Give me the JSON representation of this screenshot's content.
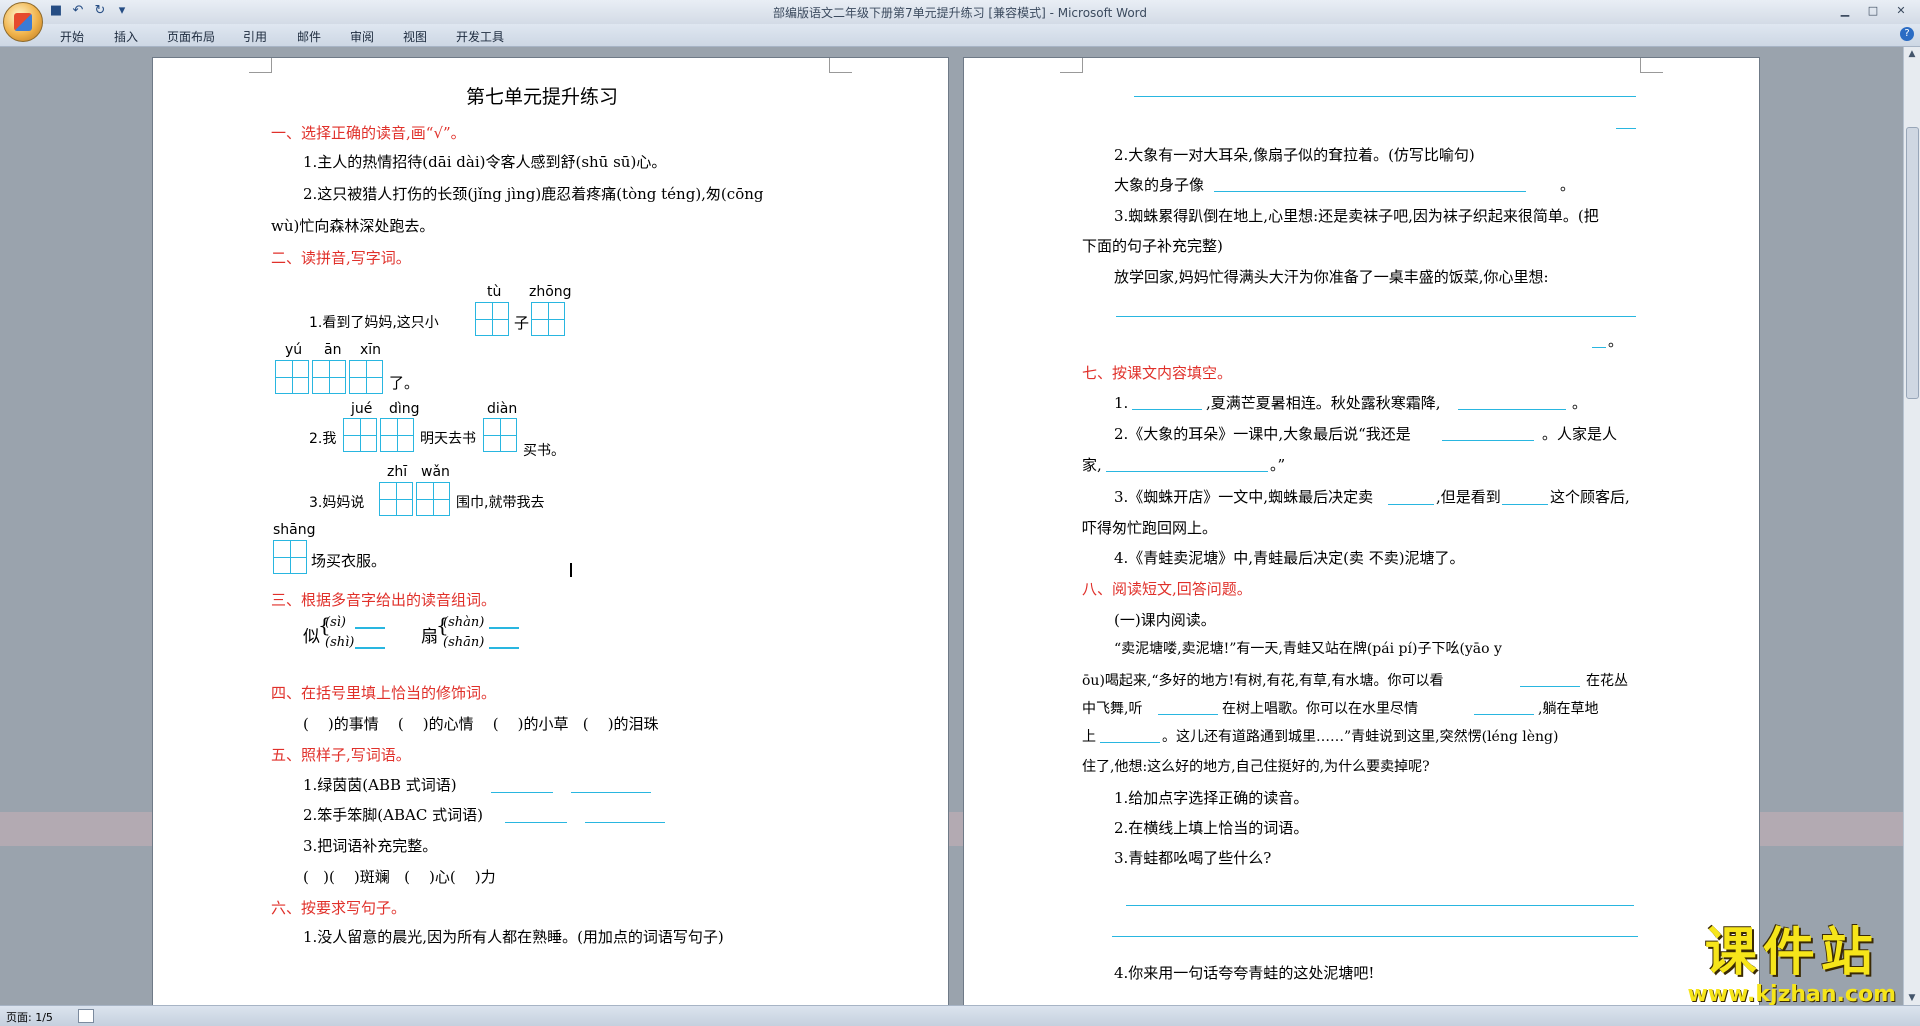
{
  "window": {
    "title": "部编版语文二年级下册第7单元提升练习 [兼容模式] - Microsoft Word",
    "controls": [
      "minimize-icon",
      "maximize-icon",
      "close-icon"
    ]
  },
  "quick_access": [
    "save-icon",
    "undo-icon",
    "redo-icon",
    "customize-icon"
  ],
  "menu": {
    "tabs": [
      "开始",
      "插入",
      "页面布局",
      "引用",
      "邮件",
      "审阅",
      "视图",
      "开发工具"
    ]
  },
  "status": {
    "page": "页面: 1/5"
  },
  "watermark": {
    "text": "课件站",
    "url": "www.kjzhan.com"
  },
  "colors": {
    "heading_red": "#e0302a",
    "blank_line": "#29b6e0",
    "chrome": "#d3dbe6"
  },
  "left_page": {
    "title": "第七单元提升练习",
    "sec1": {
      "heading": "一、选择正确的读音,画“√”。",
      "q1": "1.主人的热情招待(dāi dài)令客人感到舒(shū sū)心。",
      "q2a": "2.这只被猎人打伤的长颈(jǐng jìng)鹿忍着疼痛(tòng téng),匆(cōng",
      "q2b": "wù)忙向森林深处跑去。"
    },
    "sec2": {
      "heading": "二、读拼音,写字词。",
      "q1_text": "1.看到了妈妈,这只小",
      "q1_py1": "tù",
      "q1_py2": "zhōng",
      "q1_mid": "子",
      "q1_py3": "yú",
      "q1_py4": "ān",
      "q1_py5": "xīn",
      "q1_end": "了。",
      "q2_text": "2.我",
      "q2_py1": "jué",
      "q2_py2": "dìng",
      "q2_mid": "明天去书",
      "q2_py3": "diàn",
      "q2_end": "买书。",
      "q3_text": "3.妈妈说",
      "q3_py1": "zhī",
      "q3_py2": "wǎn",
      "q3_mid": "围巾,就带我去",
      "q3_py3": "shāng",
      "q3_end": "场买衣服。"
    },
    "sec3": {
      "heading": "三、根据多音字给出的读音组词。",
      "c1": "似",
      "c1a": "(sì)",
      "c1b": "(shì)",
      "c2": "扇",
      "c2a": "(shàn)",
      "c2b": "(shān)"
    },
    "sec4": {
      "heading": "四、在括号里填上恰当的修饰词。",
      "line": "(    )的事情    (    )的心情    (    )的小草   (    )的泪珠"
    },
    "sec5": {
      "heading": "五、照样子,写词语。",
      "q1": "1.绿茵茵(ABB 式词语)",
      "q2": "2.笨手笨脚(ABAC 式词语)",
      "q3": "3.把词语补充完整。",
      "q3_line": "(   )(    )斑斓   (    )心(    )力"
    },
    "sec6": {
      "heading": "六、按要求写句子。",
      "q1": "1.没人留意的晨光,因为所有人都在熟睡。(用加点的词语写句子)"
    }
  },
  "right_page": {
    "q2": "2.大象有一对大耳朵,像扇子似的耷拉着。(仿写比喻句)",
    "q2_ans": "大象的身子像",
    "q2_end": "。",
    "q3a": "3.蜘蛛累得趴倒在地上,心里想:还是卖袜子吧,因为袜子织起来很简单。(把",
    "q3b": "下面的句子补充完整)",
    "q3c": "放学回家,妈妈忙得满头大汗为你准备了一桌丰盛的饭菜,你心里想:",
    "q3_end": "。",
    "sec7": {
      "heading": "七、按课文内容填空。",
      "q1a": "1.",
      "q1b": ",夏满芒夏暑相连。秋处露秋寒霜降,",
      "q1c": "。",
      "q2a": "2.《大象的耳朵》一课中,大象最后说“我还是",
      "q2b": "。人家是人",
      "q2c": "家,",
      "q2d": "。”",
      "q3a": "3.《蜘蛛开店》一文中,蜘蛛最后决定卖",
      "q3b": ",但是看到",
      "q3c": "这个顾客后,",
      "q3d": "吓得匆忙跑回网上。",
      "q4": "4.《青蛙卖泥塘》中,青蛙最后决定(卖  不卖)泥塘了。"
    },
    "sec8": {
      "heading": "八、阅读短文,回答问题。",
      "sub": "(一)课内阅读。",
      "p1": "“卖泥塘喽,卖泥塘!”有一天,青蛙又站在牌(pái pí)子下吆(yāo y",
      "p2a": "ōu)喝起来,“多好的地方!有树,有花,有草,有水塘。你可以看",
      "p2b": "在花丛",
      "p3a": "中飞舞,听",
      "p3b": "在树上唱歌。你可以在水里尽情",
      "p3c": ",躺在草地",
      "p4a": "上",
      "p4b": "。这儿还有道路通到城里……”青蛙说到这里,突然愣(léng lèng)",
      "p5": "住了,他想:这么好的地方,自己住挺好的,为什么要卖掉呢?",
      "q1": "1.给加点字选择正确的读音。",
      "q2": "2.在横线上填上恰当的词语。",
      "q3": "3.青蛙都吆喝了些什么?",
      "q4": "4.你来用一句话夸夸青蛙的这处泥塘吧!"
    }
  }
}
